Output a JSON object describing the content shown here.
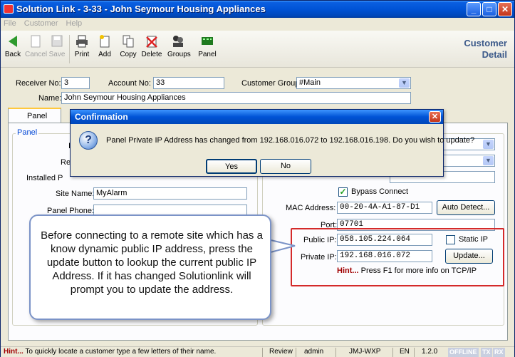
{
  "window": {
    "title": "Solution Link - 3-33 - John Seymour Housing Appliances",
    "minimize": "_",
    "maximize": "□",
    "close": "✕"
  },
  "menu": [
    "File",
    "Customer",
    "Help"
  ],
  "toolbar": {
    "back": "Back",
    "cancel": "Cancel",
    "save": "Save",
    "print": "Print",
    "add": "Add",
    "copy": "Copy",
    "delete": "Delete",
    "groups": "Groups",
    "panel": "Panel",
    "detail_title_1": "Customer",
    "detail_title_2": "Detail"
  },
  "header": {
    "receiver_label": "Receiver No:",
    "receiver_value": "3",
    "account_label": "Account No:",
    "account_value": "33",
    "group_label": "Customer Group:",
    "group_value": "#Main",
    "name_label": "Name:",
    "name_value": "John Seymour Housing Appliances"
  },
  "tabs": {
    "panel_tab": "Panel"
  },
  "panel_group": {
    "label": "Panel",
    "partial_label_1": "I",
    "partial_label_2": "Re",
    "partial_label_3": "Installed P",
    "site_name_label": "Site Name:",
    "site_name_value": "MyAlarm",
    "panel_phone_label": "Panel Phone:",
    "panel_phone_value": ""
  },
  "network": {
    "bypass_label": "Bypass Connect",
    "bypass_checked": true,
    "mac_label": "MAC Address:",
    "mac_value": "00-20-4A-A1-87-D1",
    "auto_detect": "Auto Detect...",
    "port_label": "Port:",
    "port_value": "07701",
    "public_ip_label": "Public IP:",
    "public_ip_value": "058.105.224.064",
    "static_ip_label": "Static IP",
    "static_ip_checked": false,
    "private_ip_label": "Private IP:",
    "private_ip_value": "192.168.016.072",
    "update_button": "Update...",
    "hint_bold": "Hint...",
    "hint_text": " Press F1 for more info on TCP/IP"
  },
  "dialog": {
    "title": "Confirmation",
    "icon": "question-icon",
    "message": "Panel Private IP Address has changed from 192.168.016.072 to 192.168.016.198. Do you wish to update?",
    "yes": "Yes",
    "no": "No"
  },
  "callout": {
    "text": "Before connecting to a remote site which has a know dynamic public IP address, press the update button to lookup the current public IP Address. If it has changed Solutionlink will prompt you to update the address."
  },
  "statusbar": {
    "hint_bold": "Hint...",
    "hint_text": " To quickly locate a customer type a few letters of their name.",
    "review": "Review",
    "user": "admin",
    "machine": "JMJ-WXP",
    "lang": "EN",
    "version": "1.2.0",
    "offline": "OFFLINE",
    "tx": "TX",
    "rx": "RX"
  },
  "colors": {
    "titlebar": "#0053d6",
    "highlight": "#d42a2a",
    "hint": "#a00000"
  }
}
